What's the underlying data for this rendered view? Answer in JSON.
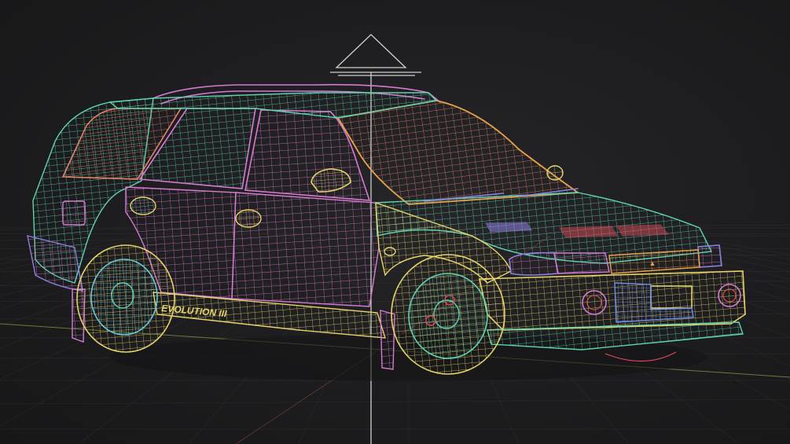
{
  "viewport": {
    "background": "#1c1c1e",
    "grid_color": "#3a3a3c",
    "axis_x_color": "#6b7a3a",
    "axis_z_color": "#7a3a3a"
  },
  "model": {
    "subject": "car",
    "render_mode": "wireframe",
    "badge_text": "EVOLUTION III",
    "colors": {
      "teal": "#5fd3b0",
      "pink": "#d77ad1",
      "salmon": "#e3836a",
      "yellow": "#e6d36a",
      "orange": "#e8a24a",
      "purple": "#8e7ee0",
      "cyan": "#66c6d6",
      "red": "#d94b58",
      "blue": "#6c8ee8"
    }
  },
  "gizmo": {
    "type": "camera-frustum-icon",
    "color": "#d0d0d0"
  }
}
